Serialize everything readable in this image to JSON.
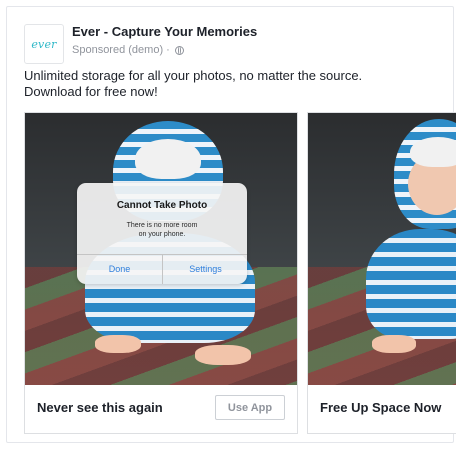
{
  "advertiser": {
    "logo_text": "ever",
    "name": "Ever - Capture Your Memories",
    "sponsored_label": "Sponsored (demo) ·",
    "audience_icon": "globe-icon"
  },
  "post": {
    "text_line1": "Unlimited storage for all your photos, no matter the source.",
    "text_line2": "Download for free now!"
  },
  "carousel": {
    "cards": [
      {
        "image": "baby-crawling-with-dialog",
        "dialog": {
          "title": "Cannot Take Photo",
          "message_line1": "There is no more room",
          "message_line2": "on your phone.",
          "left_button": "Done",
          "right_button": "Settings"
        },
        "headline": "Never see this again",
        "cta_label": "Use App"
      },
      {
        "image": "baby-crawling-smiling",
        "headline": "Free Up Space Now"
      }
    ]
  },
  "colors": {
    "brand": "#2fb8c8",
    "ios_blue": "#2f7fdc",
    "muted_text": "#90949c"
  }
}
